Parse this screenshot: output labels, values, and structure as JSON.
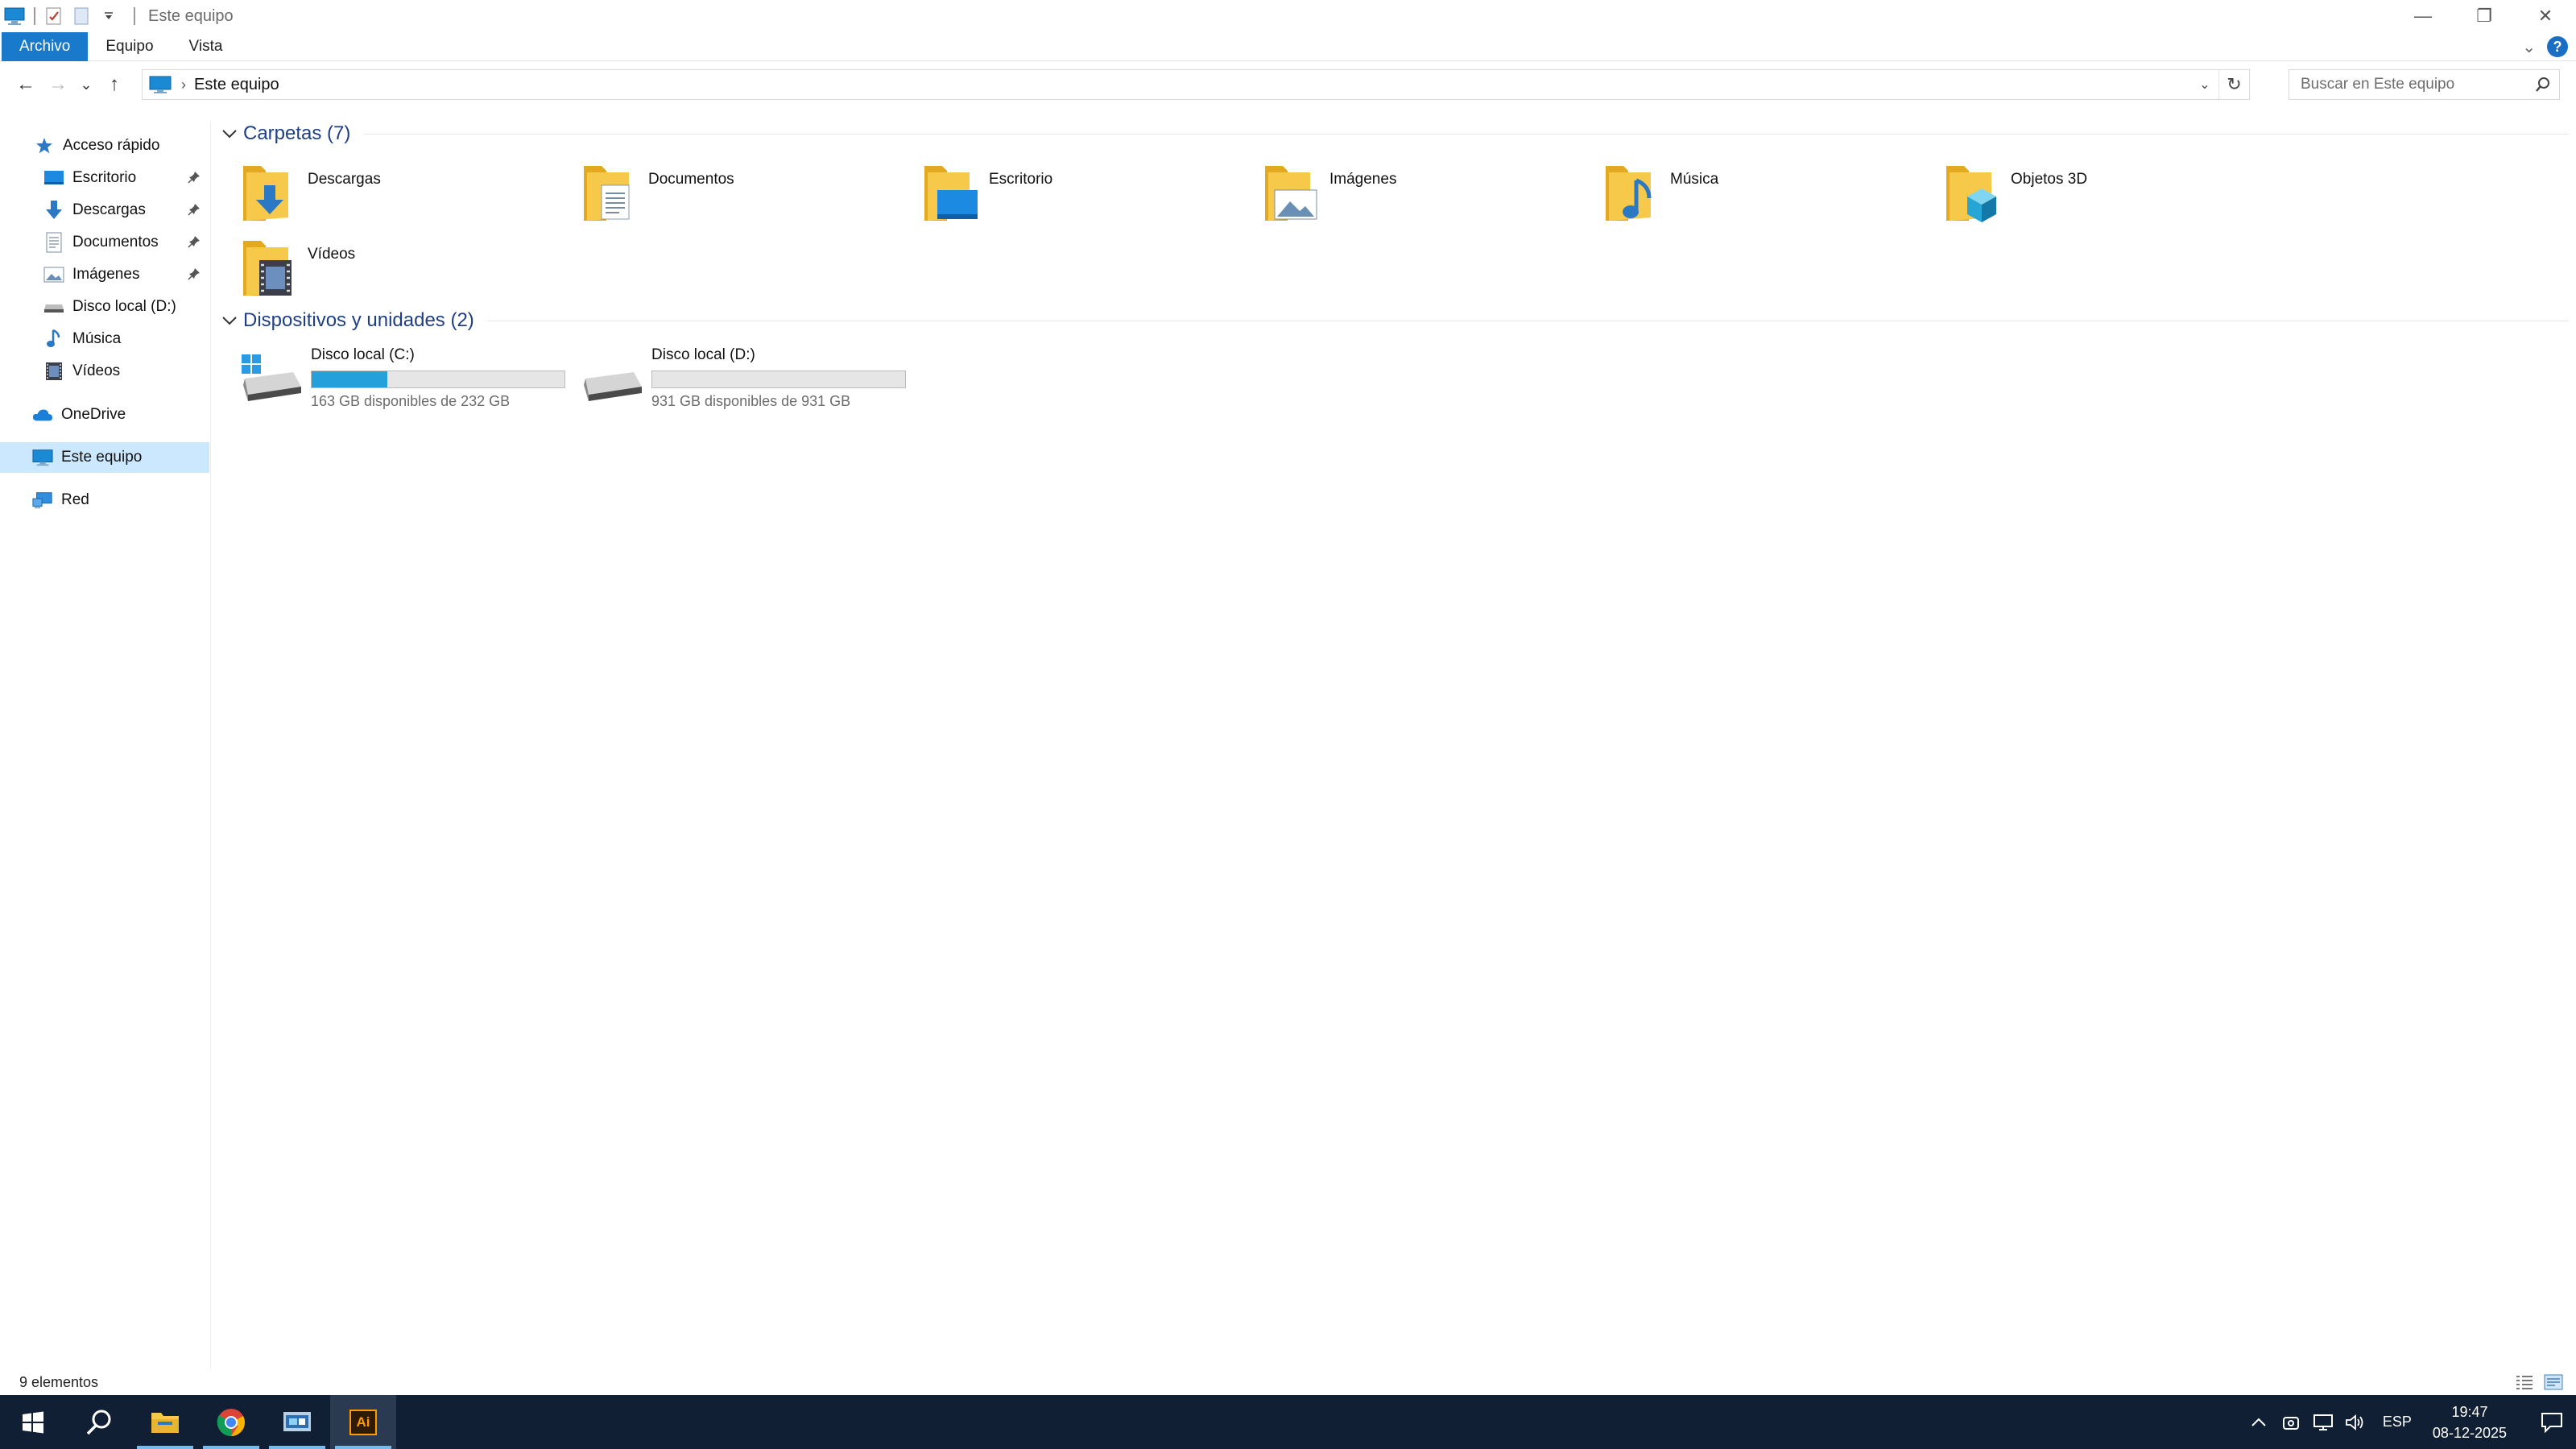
{
  "window": {
    "title": "Este equipo",
    "controls": {
      "minimize": "—",
      "maximize": "❐",
      "close": "✕"
    }
  },
  "ribbon": {
    "tabs": [
      "Archivo",
      "Equipo",
      "Vista"
    ],
    "collapse_glyph": "⌄",
    "help_glyph": "?"
  },
  "navigation": {
    "back": "←",
    "forward": "→",
    "recent": "⌄",
    "up": "↑",
    "address": "Este equipo",
    "address_separator": "›",
    "dropdown": "⌄",
    "refresh": "↻",
    "search_placeholder": "Buscar en Este equipo"
  },
  "sidebar": {
    "quick_access": "Acceso rápido",
    "quick_items": [
      {
        "label": "Escritorio",
        "pinned": true,
        "icon": "desktop-icon"
      },
      {
        "label": "Descargas",
        "pinned": true,
        "icon": "download-icon"
      },
      {
        "label": "Documentos",
        "pinned": true,
        "icon": "document-icon"
      },
      {
        "label": "Imágenes",
        "pinned": true,
        "icon": "pictures-icon"
      },
      {
        "label": "Disco local (D:)",
        "pinned": false,
        "icon": "drive-icon"
      },
      {
        "label": "Música",
        "pinned": false,
        "icon": "music-icon"
      },
      {
        "label": "Vídeos",
        "pinned": false,
        "icon": "video-icon"
      }
    ],
    "onedrive": "OneDrive",
    "this_pc": "Este equipo",
    "network": "Red"
  },
  "folders": {
    "title": "Carpetas (7)",
    "items": [
      {
        "name": "Descargas",
        "overlay": "download"
      },
      {
        "name": "Documentos",
        "overlay": "document"
      },
      {
        "name": "Escritorio",
        "overlay": "desktop"
      },
      {
        "name": "Imágenes",
        "overlay": "pictures"
      },
      {
        "name": "Música",
        "overlay": "music"
      },
      {
        "name": "Objetos 3D",
        "overlay": "3d"
      },
      {
        "name": "Vídeos",
        "overlay": "video"
      }
    ]
  },
  "devices": {
    "title": "Dispositivos y unidades (2)",
    "items": [
      {
        "name": "Disco local (C:)",
        "info": "163 GB disponibles de 232 GB",
        "used_fraction": 0.3,
        "system": true
      },
      {
        "name": "Disco local (D:)",
        "info": "931 GB disponibles de 931 GB",
        "used_fraction": 0.0,
        "system": false
      }
    ]
  },
  "status": {
    "count": "9 elementos"
  },
  "taskbar": {
    "language": "ESP",
    "time": "19:47",
    "date": "08-12-2025",
    "apps": [
      "start-icon",
      "search-icon",
      "file-explorer-icon",
      "chrome-icon",
      "remote-desktop-icon",
      "illustrator-icon"
    ],
    "illustrator_label": "Ai"
  },
  "colors": {
    "accent": "#1979ca",
    "progress": "#26a0da",
    "folder": "#f6c94b",
    "taskbar": "#101f33",
    "selected": "#cce8ff"
  }
}
